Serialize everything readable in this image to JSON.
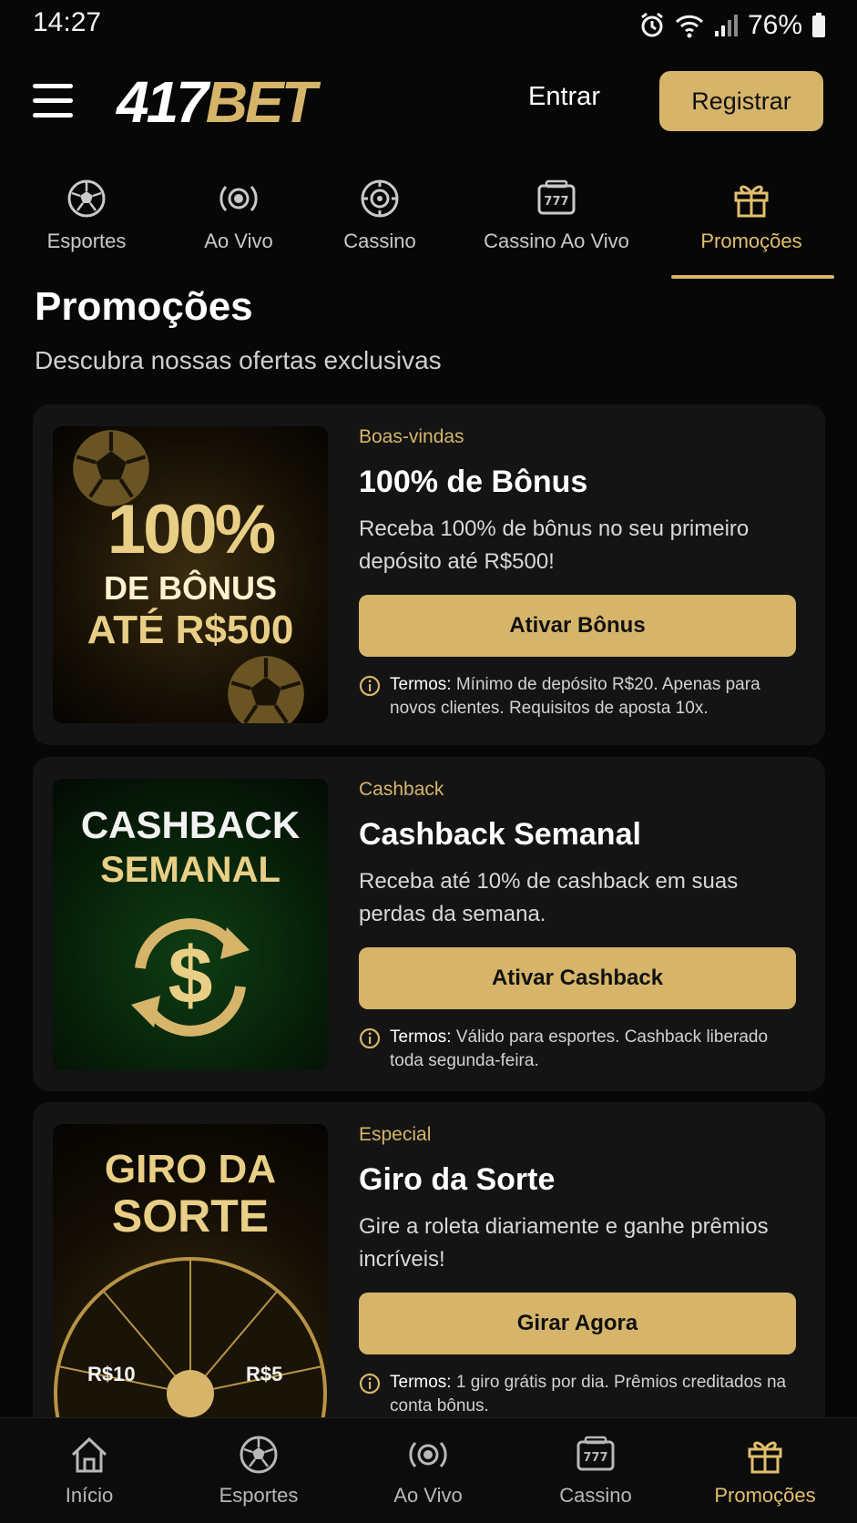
{
  "status_bar": {
    "time": "14:27",
    "battery": "76%"
  },
  "header": {
    "logo_number": "417",
    "logo_brand": "BET",
    "login_label": "Entrar",
    "register_label": "Registrar"
  },
  "categories": [
    {
      "label": "Esportes",
      "icon": "soccer-ball-icon"
    },
    {
      "label": "Ao Vivo",
      "icon": "live-broadcast-icon"
    },
    {
      "label": "Cassino",
      "icon": "roulette-icon"
    },
    {
      "label": "Cassino Ao Vivo",
      "icon": "slot-machine-icon"
    },
    {
      "label": "Promoções",
      "icon": "gift-icon",
      "active": true
    }
  ],
  "page": {
    "title": "Promoções",
    "subtitle": "Descubra nossas ofertas exclusivas"
  },
  "promos": [
    {
      "tag": "Boas-vindas",
      "title": "100% de Bônus",
      "description": "Receba 100% de bônus no seu primeiro depósito até R$500!",
      "button": "Ativar Bônus",
      "terms_label": "Termos:",
      "terms": "Mínimo de depósito R$20. Apenas para novos clientes. Requisitos de aposta 10x.",
      "image_lines": [
        "100%",
        "DE BÔNUS",
        "ATÉ R$500"
      ]
    },
    {
      "tag": "Cashback",
      "title": "Cashback Semanal",
      "description": "Receba até 10% de cashback em suas perdas da semana.",
      "button": "Ativar Cashback",
      "terms_label": "Termos:",
      "terms": "Válido para esportes. Cashback liberado toda segunda-feira.",
      "image_lines": [
        "CASHBACK",
        "SEMANAL",
        "$"
      ]
    },
    {
      "tag": "Especial",
      "title": "Giro da Sorte",
      "description": "Gire a roleta diariamente e ganhe prêmios incríveis!",
      "button": "Girar Agora",
      "terms_label": "Termos:",
      "terms": "1 giro grátis por dia. Prêmios creditados na conta bônus.",
      "image_lines": [
        "GIRO DA",
        "SORTE",
        "R$10",
        "R$5"
      ]
    }
  ],
  "bottom_nav": [
    {
      "label": "Início",
      "icon": "home-icon"
    },
    {
      "label": "Esportes",
      "icon": "soccer-ball-icon"
    },
    {
      "label": "Ao Vivo",
      "icon": "live-broadcast-icon"
    },
    {
      "label": "Cassino",
      "icon": "slot-machine-icon"
    },
    {
      "label": "Promoções",
      "icon": "gift-icon",
      "active": true
    }
  ],
  "colors": {
    "accent": "#d6b56a",
    "background": "#070707",
    "card": "#141414"
  }
}
